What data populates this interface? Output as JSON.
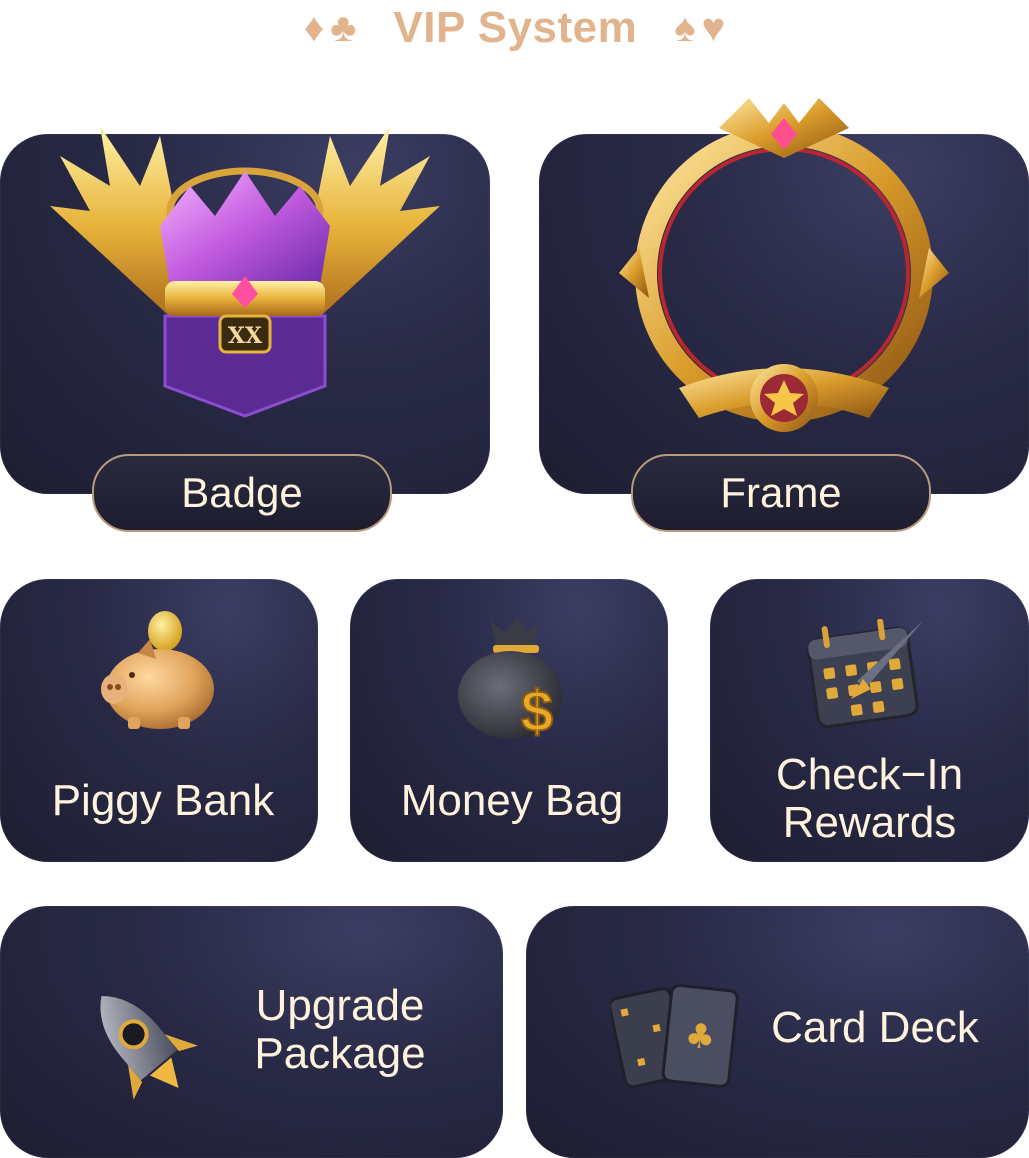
{
  "header": {
    "title": "VIP System",
    "suits_left": [
      "♦",
      "♣"
    ],
    "suits_right": [
      "♠",
      "♥"
    ],
    "accent_color": "#e2b48d"
  },
  "cards": {
    "badge": {
      "label": "Badge",
      "icon": "winged-crown-badge-icon"
    },
    "frame": {
      "label": "Frame",
      "icon": "gold-avatar-frame-icon"
    },
    "piggy_bank": {
      "label": "Piggy Bank",
      "icon": "piggy-bank-icon"
    },
    "money_bag": {
      "label": "Money Bag",
      "icon": "money-bag-icon"
    },
    "check_in": {
      "label_line1": "Check−In",
      "label_line2": "Rewards",
      "icon": "calendar-icon"
    },
    "upgrade": {
      "label_line1": "Upgrade",
      "label_line2": "Package",
      "icon": "rocket-icon"
    },
    "card_deck": {
      "label": "Card Deck",
      "icon": "playing-cards-icon"
    }
  },
  "colors": {
    "card_bg": "#282945",
    "label_text": "#fff3dd",
    "pill_border": "#b89a7e",
    "gold": "#e0a93a"
  }
}
